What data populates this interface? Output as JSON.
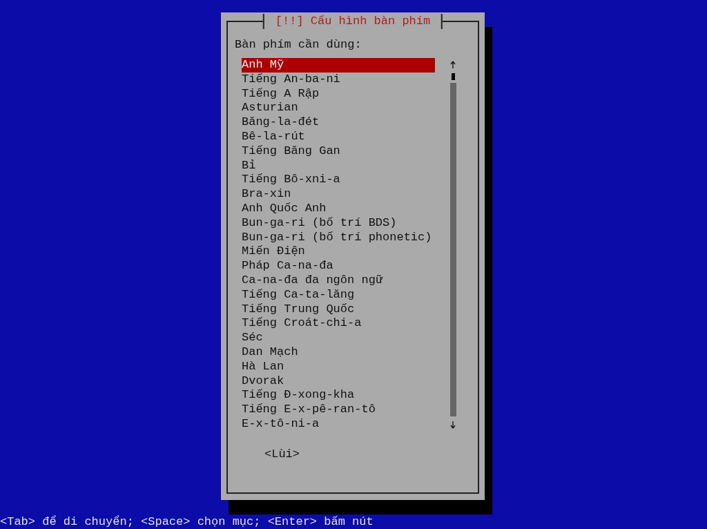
{
  "dialog": {
    "title": "[!!] Cấu hình bàn phím",
    "prompt": "Bàn phím cần dùng:",
    "items": [
      {
        "label": "Anh Mỹ",
        "selected": true
      },
      {
        "label": "Tiếng An-ba-ni",
        "selected": false
      },
      {
        "label": "Tiếng A Rập",
        "selected": false
      },
      {
        "label": "Asturian",
        "selected": false
      },
      {
        "label": "Băng-la-đét",
        "selected": false
      },
      {
        "label": "Bê-la-rút",
        "selected": false
      },
      {
        "label": "Tiếng Băng Gan",
        "selected": false
      },
      {
        "label": "Bỉ",
        "selected": false
      },
      {
        "label": "Tiếng Bô-xni-a",
        "selected": false
      },
      {
        "label": "Bra-xin",
        "selected": false
      },
      {
        "label": "Anh Quốc Anh",
        "selected": false
      },
      {
        "label": "Bun-ga-ri (bố trí BDS)",
        "selected": false
      },
      {
        "label": "Bun-ga-ri (bố trí phonetic)",
        "selected": false
      },
      {
        "label": "Miến Điện",
        "selected": false
      },
      {
        "label": "Pháp Ca-na-đa",
        "selected": false
      },
      {
        "label": "Ca-na-đa đa ngôn ngữ",
        "selected": false
      },
      {
        "label": "Tiếng Ca-ta-lăng",
        "selected": false
      },
      {
        "label": "Tiếng Trung Quốc",
        "selected": false
      },
      {
        "label": "Tiếng Croát-chi-a",
        "selected": false
      },
      {
        "label": "Séc",
        "selected": false
      },
      {
        "label": "Dan Mạch",
        "selected": false
      },
      {
        "label": "Hà Lan",
        "selected": false
      },
      {
        "label": "Dvorak",
        "selected": false
      },
      {
        "label": "Tiếng Đ-xong-kha",
        "selected": false
      },
      {
        "label": "Tiếng E-x-pê-ran-tô",
        "selected": false
      },
      {
        "label": "E-x-tô-ni-a",
        "selected": false
      }
    ],
    "buttons": [
      {
        "label": "<Lùi>"
      }
    ]
  },
  "status_bar": "<Tab> để di chuyển; <Space> chọn mục; <Enter> bấm nút"
}
